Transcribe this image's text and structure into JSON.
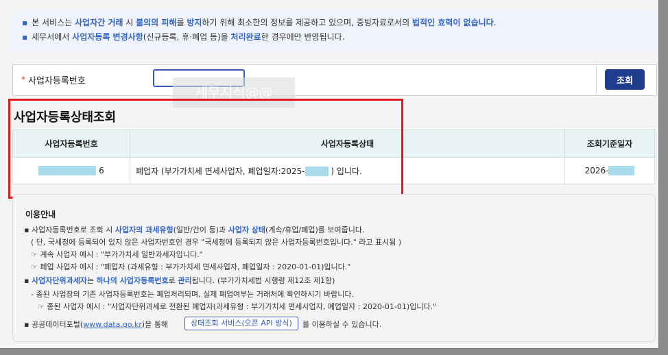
{
  "notice": {
    "line1": {
      "a": "본 서비스는 ",
      "b1": "사업자간 거래",
      "c": " 시 ",
      "b2": "불의의 피해",
      "d": "를 ",
      "b3": "방지",
      "e": "하기 위해 최소한의 정보를 제공하고 있으며, 증빙자료로서의 ",
      "b4": "법적인 효력이 없습니다",
      "f": "."
    },
    "line2": {
      "a": "세무서에서 ",
      "b1": "사업자등록 변경사항",
      "c": "(신규등록, 휴·폐업 등)을 ",
      "b2": "처리완료",
      "d": "한 경우에만 반영됩니다."
    },
    "bullet": "▪"
  },
  "lookup": {
    "required_mark": "*",
    "label": "사업자등록번호",
    "input_value": "",
    "button": "조회"
  },
  "watermark": "세무지식@@",
  "result": {
    "title": "사업자등록상태조회",
    "headers": [
      "사업자등록번호",
      "사업자등록상태",
      "조회기준일자"
    ],
    "row": {
      "reg_no_suffix": "6",
      "status_prefix": "폐업자 (부가가치세 면세사업자, 폐업일자:2025-",
      "status_suffix": ") 입니다.",
      "date_prefix": "2026-"
    }
  },
  "guide": {
    "title": "이용안내",
    "l1": {
      "a": "사업자등록번호로 조회 시 ",
      "b1": "사업자의 과세유형",
      "c": "(일반/간이 등)과 ",
      "b2": "사업자 상태",
      "d": "(계속/휴업/폐업)를 보여줍니다."
    },
    "l2": "( 단, 국세청에 등록되어 있지 않은 사업자번호인 경우 \"국세청에 등록되지 않은 사업자등록번호입니다.\" 라고 표시됨 )",
    "l3": "☞ 계속 사업자 예시 : \"부가가치세 일반과세자입니다.\"",
    "l4": "☞ 폐업 사업자 예시 : \"폐업자 (과세유형 : 부가가치세 면세사업자, 폐업일자 : 2020-01-01)입니다.\"",
    "l5": {
      "b1": "사업자단위과세자",
      "a": "는 ",
      "b2": "하나의 사업자등록번호",
      "c": "로 ",
      "b3": "관리",
      "d": "됩니다. (부가가치세법 시행령 제12조 제1항)"
    },
    "l6": "- 종된 사업장의 기존 사업자등록번호는 폐업처리되며, 실제 폐업여부는 거래처에 확인하시기 바랍니다.",
    "l7": "☞ 종된 사업자 예시 : \"사업자단위과세로 전환된 폐업자(과세유형 : 부가가치세 면세사업자, 폐업일자 : 2020-01-01)입니다.\"",
    "l8": {
      "a": "공공데이터포털(",
      "link": "www.data.go.kr",
      "b": ")을 통해",
      "c": "를 이용하실 수 있습니다."
    },
    "api_button": "상태조회 서비스(오픈 API 방식)",
    "bullet": "▪"
  }
}
